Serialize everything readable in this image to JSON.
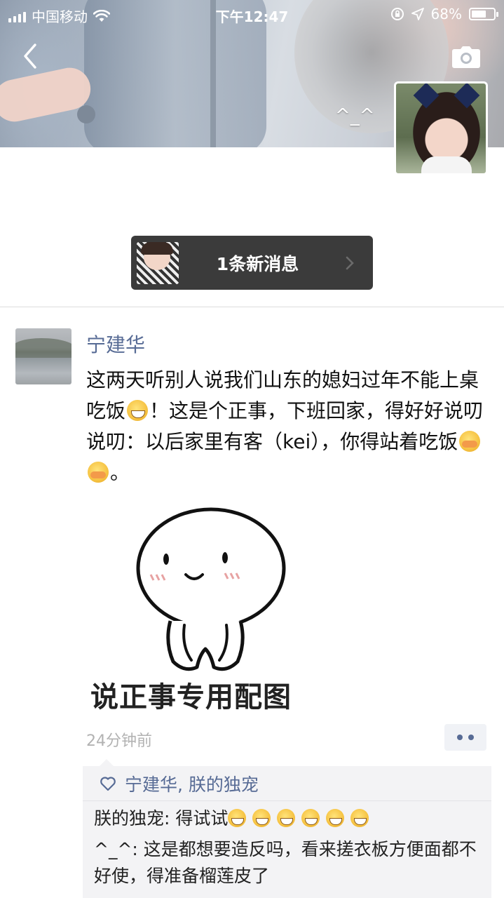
{
  "status_bar": {
    "carrier": "中国移动",
    "time": "下午12:47",
    "battery": "68%",
    "battery_level": 0.68
  },
  "cover": {
    "caption": "^_^"
  },
  "new_message": {
    "label": "1条新消息"
  },
  "post": {
    "author": "宁建华",
    "text_segments": [
      "这两天听别人说我们山东的媳妇过年不能上桌吃饭",
      "！这是个正事，下班回家，得好好说叨说叨：以后家里有客（kei），你得站着吃饭",
      "。"
    ],
    "meme_caption": "说正事专用配图",
    "time": "24分钟前"
  },
  "likes": {
    "names": "宁建华, 朕的独宠"
  },
  "comments": [
    {
      "author": "朕的独宠",
      "separator": ": ",
      "text": "得试试"
    },
    {
      "author": "^_^",
      "separator": ": ",
      "text": "这是都想要造反吗，看来搓衣板方便面都不好使，得准备榴莲皮了"
    }
  ],
  "colors": {
    "link_blue": "#576b95",
    "time_gray": "#b2b2b2",
    "comment_bg": "#f3f3f5",
    "pill_bg": "#3b3b3b"
  },
  "icons": {
    "back": "back-chevron-icon",
    "camera": "camera-icon",
    "wifi": "wifi-icon",
    "location": "location-arrow-icon",
    "lock_rotation": "rotation-lock-icon",
    "more": "more-dots-icon",
    "heart": "heart-icon"
  }
}
